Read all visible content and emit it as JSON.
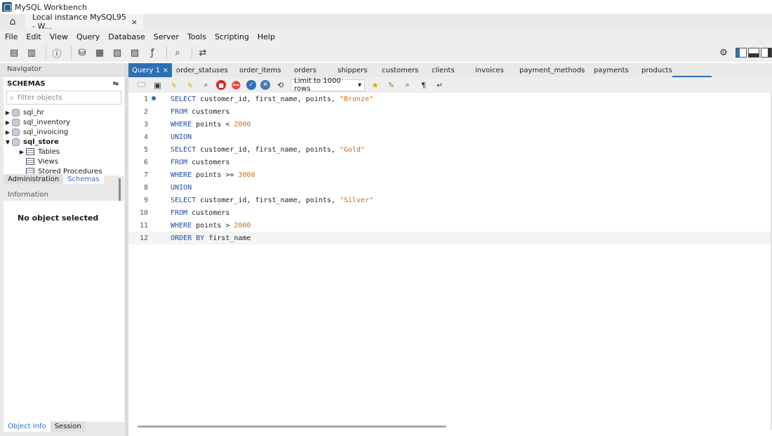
{
  "window": {
    "title": "MySQL Workbench"
  },
  "connection_tab": {
    "label": "Local instance MySQL95 - W...",
    "close": "×"
  },
  "menu": [
    "File",
    "Edit",
    "View",
    "Query",
    "Database",
    "Server",
    "Tools",
    "Scripting",
    "Help"
  ],
  "navigator": {
    "header": "Navigator",
    "schemas_title": "SCHEMAS",
    "filter_placeholder": "Filter objects",
    "schemas": [
      "sql_hr",
      "sql_inventory",
      "sql_invoicing",
      "sql_store"
    ],
    "children": [
      "Tables",
      "Views",
      "Stored Procedures"
    ],
    "bottom_tabs": [
      "Administration",
      "Schemas"
    ]
  },
  "information": {
    "header": "Information",
    "empty_text": "No object selected",
    "tabs": [
      "Object Info",
      "Session"
    ]
  },
  "editor_tabs": {
    "active": "Query 1",
    "close": "×",
    "tables": [
      "order_statuses",
      "order_items",
      "orders",
      "shippers",
      "customers",
      "clients",
      "invoices",
      "payment_methods",
      "payments",
      "products"
    ]
  },
  "sql_toolbar": {
    "limit_label": "Limit to 1000 rows"
  },
  "code": {
    "line_numbers": [
      "1",
      "2",
      "3",
      "4",
      "5",
      "6",
      "7",
      "8",
      "9",
      "10",
      "11",
      "12"
    ],
    "lines": [
      [
        [
          "kw",
          "SELECT"
        ],
        [
          "plain",
          " customer_id, first_name, points, "
        ],
        [
          "str",
          "\"Bronze\""
        ]
      ],
      [
        [
          "kw",
          "FROM"
        ],
        [
          "plain",
          " customers"
        ]
      ],
      [
        [
          "kw",
          "WHERE"
        ],
        [
          "plain",
          " points < "
        ],
        [
          "num",
          "2000"
        ]
      ],
      [
        [
          "kw",
          "UNION"
        ]
      ],
      [
        [
          "kw",
          "SELECT"
        ],
        [
          "plain",
          " customer_id, first_name, points, "
        ],
        [
          "str",
          "\"Gold\""
        ]
      ],
      [
        [
          "kw",
          "FROM"
        ],
        [
          "plain",
          " customers"
        ]
      ],
      [
        [
          "kw",
          "WHERE"
        ],
        [
          "plain",
          " points >= "
        ],
        [
          "num",
          "3000"
        ]
      ],
      [
        [
          "kw",
          "UNION"
        ]
      ],
      [
        [
          "kw",
          "SELECT"
        ],
        [
          "plain",
          " customer_id, first_name, points, "
        ],
        [
          "str",
          "\"Silver\""
        ]
      ],
      [
        [
          "kw",
          "FROM"
        ],
        [
          "plain",
          " customers"
        ]
      ],
      [
        [
          "kw",
          "WHERE"
        ],
        [
          "plain",
          " points > "
        ],
        [
          "num",
          "2000"
        ]
      ],
      [
        [
          "kw",
          "ORDER BY"
        ],
        [
          "plain",
          " first_name"
        ]
      ]
    ]
  },
  "colors": {
    "accent": "#2b70b6",
    "keyword": "#1f4fa3",
    "literal": "#c96d16"
  },
  "icons": {
    "home": "home-icon",
    "main_toolbar": [
      "new-sql-tab-icon",
      "open-sql-script-icon",
      "inspector-icon",
      "create-schema-icon",
      "create-table-icon",
      "create-view-icon",
      "create-procedure-icon",
      "create-function-icon",
      "search-table-data-icon",
      "reconnect-icon"
    ],
    "sql_toolbar": [
      "open-file-icon",
      "save-icon",
      "execute-icon",
      "execute-current-icon",
      "explain-icon",
      "stop-icon",
      "toggle-continue-icon",
      "commit-icon",
      "rollback-icon",
      "autocommit-icon",
      "beautify-icon",
      "find-icon",
      "invisible-chars-icon",
      "wrap-icon"
    ]
  }
}
